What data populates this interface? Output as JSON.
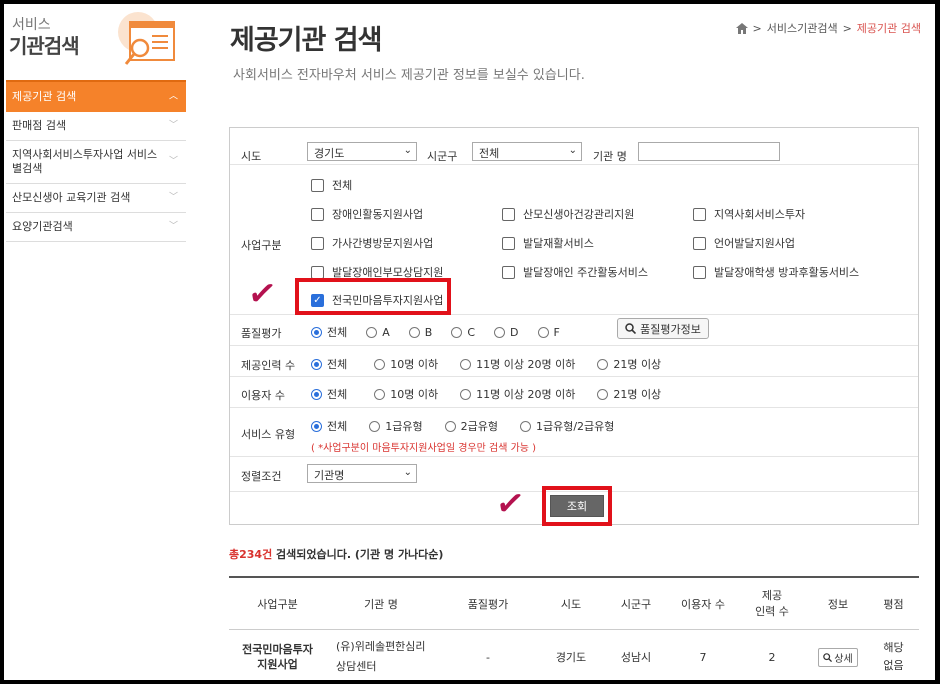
{
  "sidebar": {
    "header_small": "서비스",
    "header_big": "기관검색",
    "items": [
      {
        "label": "제공기관 검색",
        "active": true
      },
      {
        "label": "판매점 검색"
      },
      {
        "label": "지역사회서비스투자사업 서비스별검색"
      },
      {
        "label": "산모신생아 교육기관 검색"
      },
      {
        "label": "요양기관검색"
      }
    ]
  },
  "header": {
    "title": "제공기관 검색",
    "subtitle": "사회서비스 전자바우처 서비스 제공기관 정보를 보실수 있습니다.",
    "breadcrumb": [
      "서비스기관검색",
      "제공기관 검색"
    ]
  },
  "form": {
    "sido_label": "시도",
    "sido_value": "경기도",
    "sigungu_label": "시군구",
    "sigungu_value": "전체",
    "org_label": "기관 명",
    "org_value": "",
    "biz_label": "사업구분",
    "biz_options": [
      {
        "label": "전체",
        "checked": false
      },
      {
        "label": "장애인활동지원사업",
        "checked": false
      },
      {
        "label": "산모신생아건강관리지원",
        "checked": false
      },
      {
        "label": "지역사회서비스투자",
        "checked": false
      },
      {
        "label": "가사간병방문지원사업",
        "checked": false
      },
      {
        "label": "발달재활서비스",
        "checked": false
      },
      {
        "label": "언어발달지원사업",
        "checked": false
      },
      {
        "label": "발달장애인부모상담지원",
        "checked": false
      },
      {
        "label": "발달장애인 주간활동서비스",
        "checked": false
      },
      {
        "label": "발달장애학생 방과후활동서비스",
        "checked": false
      },
      {
        "label": "전국민마음투자지원사업",
        "checked": true
      }
    ],
    "quality_label": "품질평가",
    "quality_options": [
      "전체",
      "A",
      "B",
      "C",
      "D",
      "F"
    ],
    "quality_button": "품질평가정보",
    "staff_label": "제공인력 수",
    "staff_options": [
      "전체",
      "10명 이하",
      "11명 이상 20명 이하",
      "21명 이상"
    ],
    "users_label": "이용자 수",
    "users_options": [
      "전체",
      "10명 이하",
      "11명 이상 20명 이하",
      "21명 이상"
    ],
    "svc_label": "서비스 유형",
    "svc_options": [
      "전체",
      "1급유형",
      "2급유형",
      "1급유형/2급유형"
    ],
    "svc_note": "( *사업구분이 마음투자지원사업일 경우만 검색 가능 )",
    "sort_label": "정렬조건",
    "sort_value": "기관명",
    "search_button": "조회"
  },
  "results": {
    "count": "총234건",
    "suffix": "검색되었습니다. (기관 명 가나다순)",
    "headers": [
      "사업구분",
      "기관 명",
      "품질평가",
      "시도",
      "시군구",
      "이용자 수",
      "제공\n인력 수",
      "정보",
      "평점"
    ],
    "rows": [
      {
        "biz": "전국민마음투자지원사업",
        "org": "(유)위레솔편한심리상담센터",
        "quality": "-",
        "sido": "경기도",
        "sigungu": "성남시",
        "users": "7",
        "staff": "2",
        "info": "상세",
        "rating": "해당\n없음"
      }
    ]
  }
}
